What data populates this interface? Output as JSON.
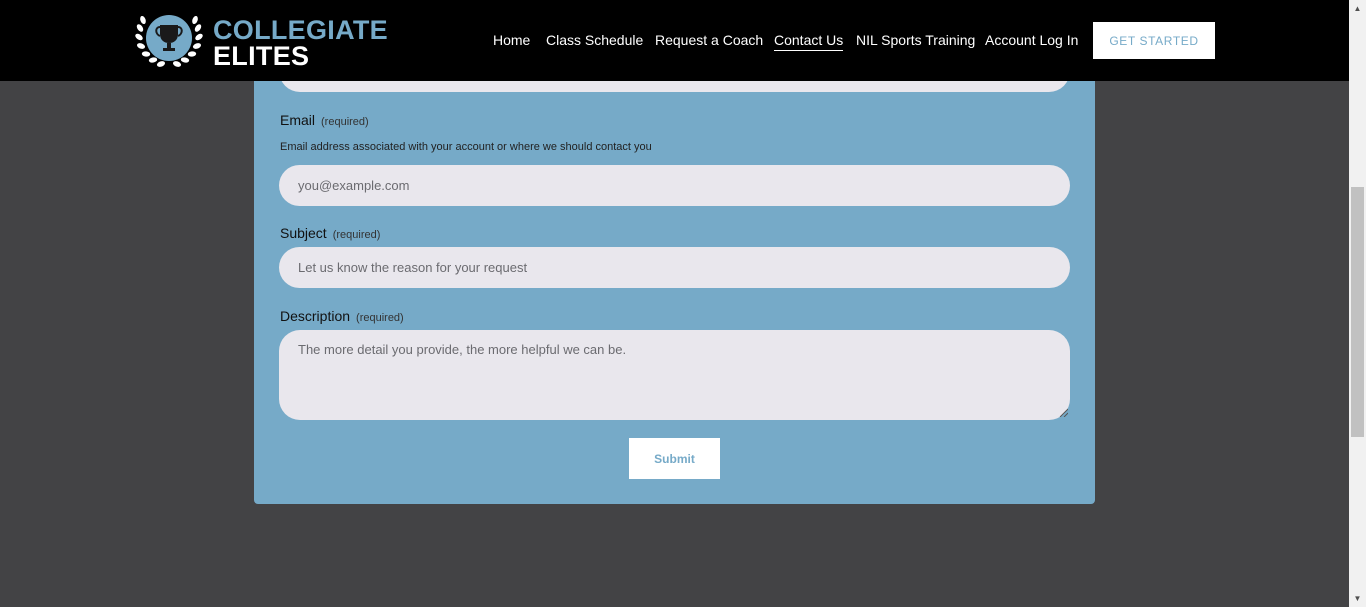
{
  "header": {
    "logo": {
      "line1": "COLLEGIATE",
      "line2": "ELITES",
      "icon": "trophy-laurel-icon"
    },
    "nav": [
      {
        "label": "Home",
        "active": false
      },
      {
        "label": "Class Schedule",
        "active": false
      },
      {
        "label": "Request a Coach",
        "active": false
      },
      {
        "label": "Contact Us",
        "active": true
      },
      {
        "label": "NIL Sports Training",
        "active": false
      },
      {
        "label": "Account Log In",
        "active": false
      }
    ],
    "cta_label": "GET STARTED"
  },
  "form": {
    "email": {
      "label": "Email",
      "required": "(required)",
      "helper": "Email address associated with your account or where we should contact you",
      "placeholder": "you@example.com"
    },
    "subject": {
      "label": "Subject",
      "required": "(required)",
      "placeholder": "Let us know the reason for your request"
    },
    "description": {
      "label": "Description",
      "required": "(required)",
      "placeholder": "The more detail you provide, the more helpful we can be."
    },
    "submit_label": "Submit"
  },
  "colors": {
    "header_bg": "#000000",
    "accent": "#76aac8",
    "page_bg": "#434345",
    "field_bg": "#e9e7ed"
  }
}
